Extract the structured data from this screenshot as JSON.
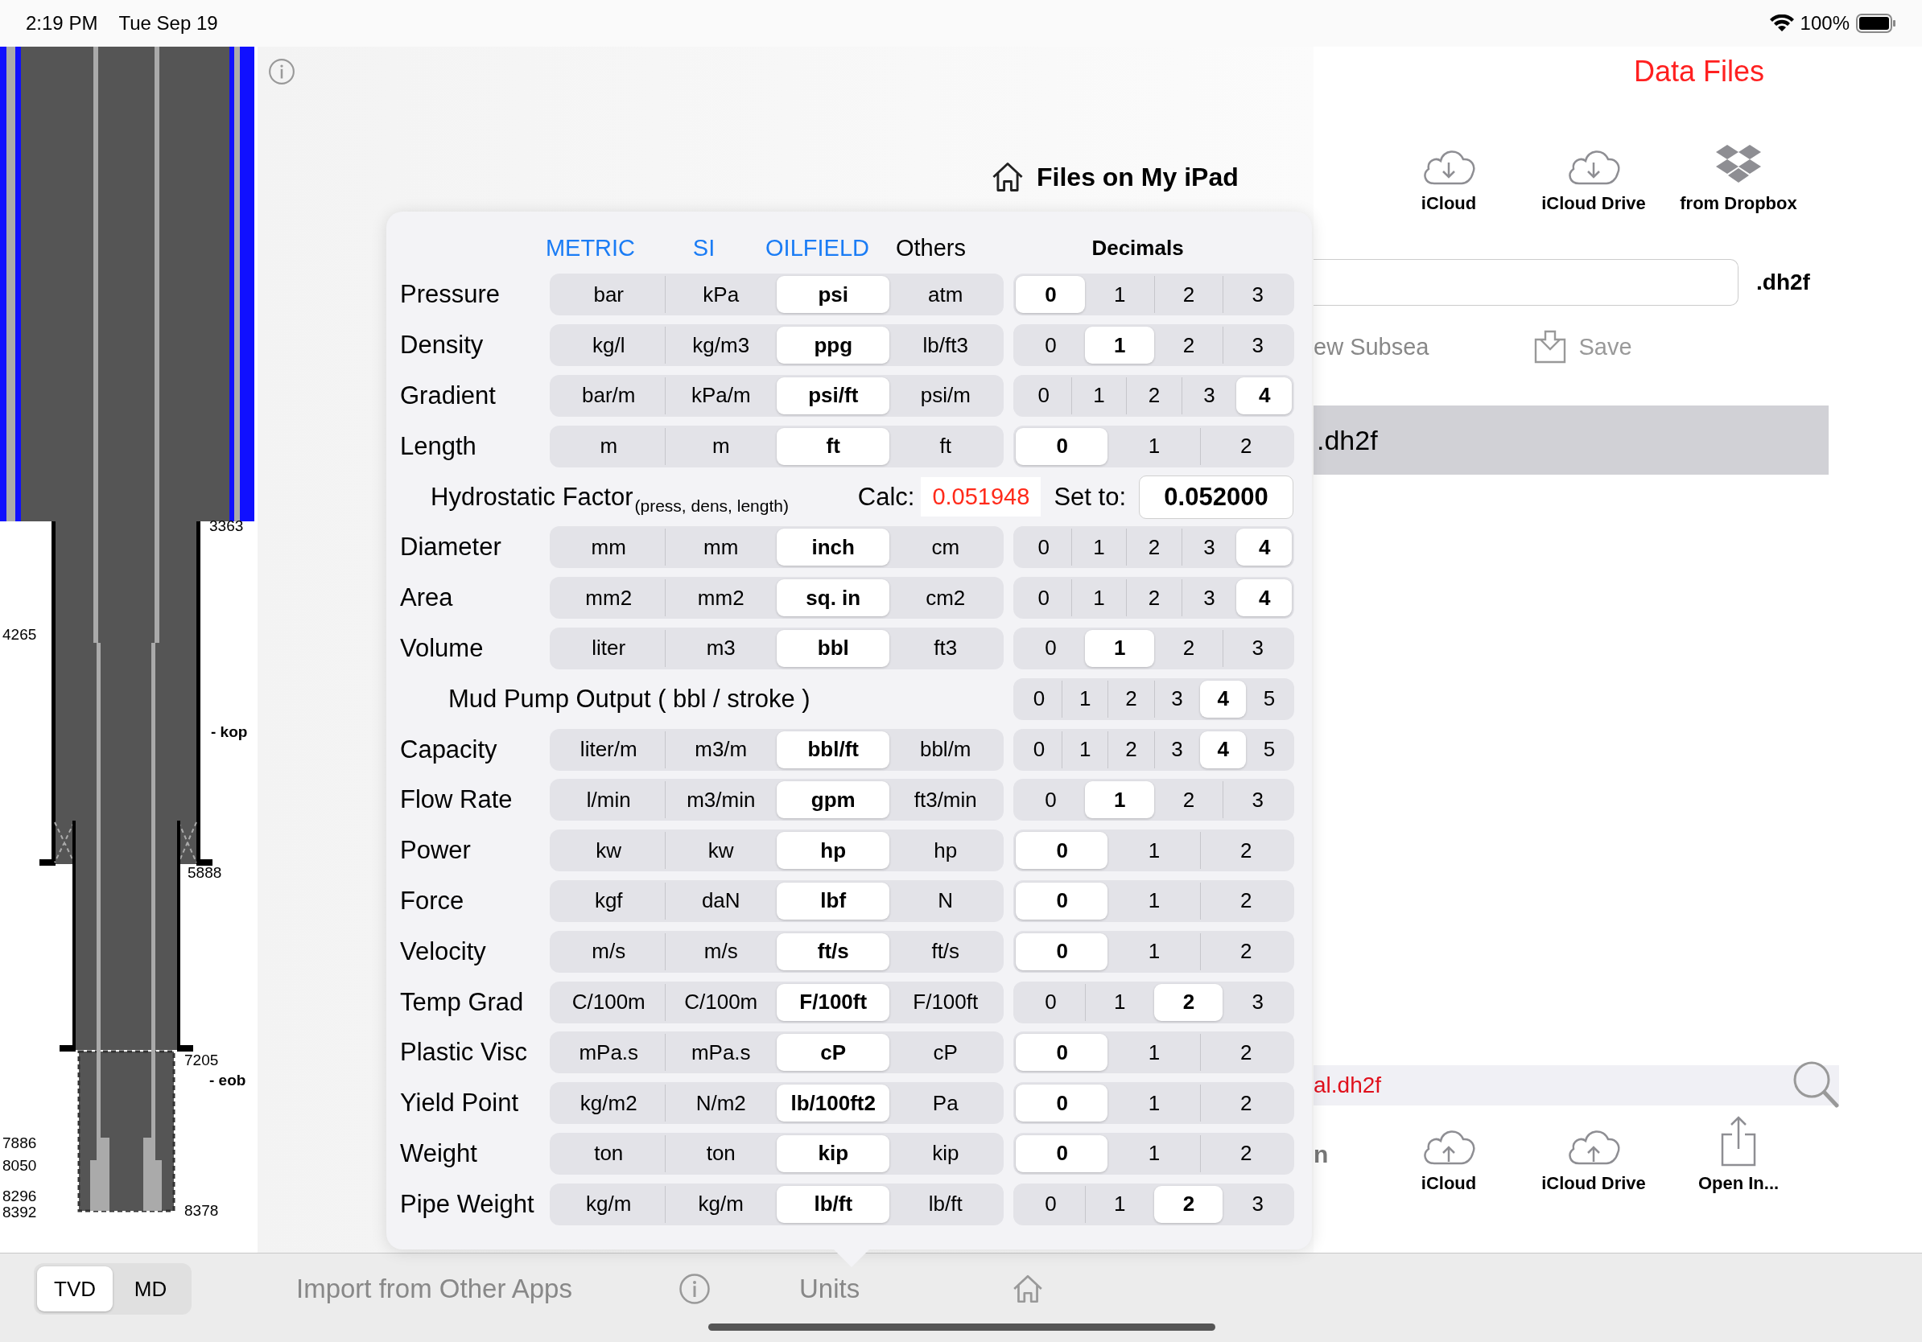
{
  "status_bar": {
    "time": "2:19 PM",
    "date": "Tue Sep 19",
    "battery": "100%"
  },
  "well": {
    "labels": [
      "3363",
      "4265",
      "- kop",
      "5888",
      "7205",
      "- eob",
      "7886",
      "8050",
      "8296",
      "8392",
      "8378"
    ]
  },
  "header": {
    "title": "Files on My iPad"
  },
  "data_files": "Data Files",
  "import_sources": [
    {
      "label": "iCloud",
      "kind": "cloud_down"
    },
    {
      "label": "iCloud Drive",
      "kind": "cloud_down"
    },
    {
      "label": "from Dropbox",
      "kind": "dropbox"
    }
  ],
  "filename_field": {
    "extension": ".dh2f"
  },
  "actions": {
    "partial_label": "ew Subsea",
    "save": "Save"
  },
  "selected_file": ".dh2f",
  "search": {
    "value": "al.dh2f"
  },
  "partial_text": "n",
  "export_targets": [
    {
      "label": "iCloud",
      "kind": "cloud_up"
    },
    {
      "label": "iCloud Drive",
      "kind": "cloud_up"
    },
    {
      "label": "Open In...",
      "kind": "share"
    }
  ],
  "units": {
    "systems": [
      {
        "label": "METRIC",
        "kind": "link"
      },
      {
        "label": "SI",
        "kind": "link"
      },
      {
        "label": "OILFIELD",
        "kind": "link"
      },
      {
        "label": "Others",
        "kind": "plain"
      }
    ],
    "decimals_title": "Decimals",
    "rows": [
      {
        "kind": "unit",
        "label": "Pressure",
        "units": [
          {
            "label": "bar",
            "selected": false
          },
          {
            "label": "kPa",
            "selected": false
          },
          {
            "label": "psi",
            "selected": true
          },
          {
            "label": "atm",
            "selected": false
          }
        ],
        "decimals": [
          {
            "label": "0",
            "selected": true
          },
          {
            "label": "1",
            "selected": false
          },
          {
            "label": "2",
            "selected": false
          },
          {
            "label": "3",
            "selected": false
          }
        ]
      },
      {
        "kind": "unit",
        "label": "Density",
        "units": [
          {
            "label": "kg/l",
            "selected": false
          },
          {
            "label": "kg/m3",
            "selected": false
          },
          {
            "label": "ppg",
            "selected": true
          },
          {
            "label": "lb/ft3",
            "selected": false
          }
        ],
        "decimals": [
          {
            "label": "0",
            "selected": false
          },
          {
            "label": "1",
            "selected": true
          },
          {
            "label": "2",
            "selected": false
          },
          {
            "label": "3",
            "selected": false
          }
        ]
      },
      {
        "kind": "unit",
        "label": "Gradient",
        "units": [
          {
            "label": "bar/m",
            "selected": false
          },
          {
            "label": "kPa/m",
            "selected": false
          },
          {
            "label": "psi/ft",
            "selected": true
          },
          {
            "label": "psi/m",
            "selected": false
          }
        ],
        "decimals": [
          {
            "label": "0",
            "selected": false
          },
          {
            "label": "1",
            "selected": false
          },
          {
            "label": "2",
            "selected": false
          },
          {
            "label": "3",
            "selected": false
          },
          {
            "label": "4",
            "selected": true
          }
        ]
      },
      {
        "kind": "unit",
        "label": "Length",
        "units": [
          {
            "label": "m",
            "selected": false
          },
          {
            "label": "m",
            "selected": false
          },
          {
            "label": "ft",
            "selected": true
          },
          {
            "label": "ft",
            "selected": false
          }
        ],
        "decimals": [
          {
            "label": "0",
            "selected": true
          },
          {
            "label": "1",
            "selected": false
          },
          {
            "label": "2",
            "selected": false
          }
        ]
      },
      {
        "kind": "hydrostatic",
        "label": "Hydrostatic Factor",
        "note": "(press, dens, length)",
        "calc_label": "Calc:",
        "calc_value": "0.051948",
        "set_label": "Set to:",
        "set_value": "0.052000"
      },
      {
        "kind": "unit",
        "label": "Diameter",
        "units": [
          {
            "label": "mm",
            "selected": false
          },
          {
            "label": "mm",
            "selected": false
          },
          {
            "label": "inch",
            "selected": true
          },
          {
            "label": "cm",
            "selected": false
          }
        ],
        "decimals": [
          {
            "label": "0",
            "selected": false
          },
          {
            "label": "1",
            "selected": false
          },
          {
            "label": "2",
            "selected": false
          },
          {
            "label": "3",
            "selected": false
          },
          {
            "label": "4",
            "selected": true
          }
        ]
      },
      {
        "kind": "unit",
        "label": "Area",
        "units": [
          {
            "label": "mm2",
            "selected": false
          },
          {
            "label": "mm2",
            "selected": false
          },
          {
            "label": "sq. in",
            "selected": true
          },
          {
            "label": "cm2",
            "selected": false
          }
        ],
        "decimals": [
          {
            "label": "0",
            "selected": false
          },
          {
            "label": "1",
            "selected": false
          },
          {
            "label": "2",
            "selected": false
          },
          {
            "label": "3",
            "selected": false
          },
          {
            "label": "4",
            "selected": true
          }
        ]
      },
      {
        "kind": "unit",
        "label": "Volume",
        "units": [
          {
            "label": "liter",
            "selected": false
          },
          {
            "label": "m3",
            "selected": false
          },
          {
            "label": "bbl",
            "selected": true
          },
          {
            "label": "ft3",
            "selected": false
          }
        ],
        "decimals": [
          {
            "label": "0",
            "selected": false
          },
          {
            "label": "1",
            "selected": true
          },
          {
            "label": "2",
            "selected": false
          },
          {
            "label": "3",
            "selected": false
          }
        ]
      },
      {
        "kind": "pump",
        "label": "Mud Pump Output (  bbl / stroke  )",
        "decimals": [
          {
            "label": "0",
            "selected": false
          },
          {
            "label": "1",
            "selected": false
          },
          {
            "label": "2",
            "selected": false
          },
          {
            "label": "3",
            "selected": false
          },
          {
            "label": "4",
            "selected": true
          },
          {
            "label": "5",
            "selected": false
          }
        ]
      },
      {
        "kind": "unit",
        "label": "Capacity",
        "units": [
          {
            "label": "liter/m",
            "selected": false
          },
          {
            "label": "m3/m",
            "selected": false
          },
          {
            "label": "bbl/ft",
            "selected": true
          },
          {
            "label": "bbl/m",
            "selected": false
          }
        ],
        "decimals": [
          {
            "label": "0",
            "selected": false
          },
          {
            "label": "1",
            "selected": false
          },
          {
            "label": "2",
            "selected": false
          },
          {
            "label": "3",
            "selected": false
          },
          {
            "label": "4",
            "selected": true
          },
          {
            "label": "5",
            "selected": false
          }
        ]
      },
      {
        "kind": "unit",
        "label": "Flow Rate",
        "units": [
          {
            "label": "l/min",
            "selected": false
          },
          {
            "label": "m3/min",
            "selected": false
          },
          {
            "label": "gpm",
            "selected": true
          },
          {
            "label": "ft3/min",
            "selected": false
          }
        ],
        "decimals": [
          {
            "label": "0",
            "selected": false
          },
          {
            "label": "1",
            "selected": true
          },
          {
            "label": "2",
            "selected": false
          },
          {
            "label": "3",
            "selected": false
          }
        ]
      },
      {
        "kind": "unit",
        "label": "Power",
        "units": [
          {
            "label": "kw",
            "selected": false
          },
          {
            "label": "kw",
            "selected": false
          },
          {
            "label": "hp",
            "selected": true
          },
          {
            "label": "hp",
            "selected": false
          }
        ],
        "decimals": [
          {
            "label": "0",
            "selected": true
          },
          {
            "label": "1",
            "selected": false
          },
          {
            "label": "2",
            "selected": false
          }
        ]
      },
      {
        "kind": "unit",
        "label": "Force",
        "units": [
          {
            "label": "kgf",
            "selected": false
          },
          {
            "label": "daN",
            "selected": false
          },
          {
            "label": "lbf",
            "selected": true
          },
          {
            "label": "N",
            "selected": false
          }
        ],
        "decimals": [
          {
            "label": "0",
            "selected": true
          },
          {
            "label": "1",
            "selected": false
          },
          {
            "label": "2",
            "selected": false
          }
        ]
      },
      {
        "kind": "unit",
        "label": "Velocity",
        "units": [
          {
            "label": "m/s",
            "selected": false
          },
          {
            "label": "m/s",
            "selected": false
          },
          {
            "label": "ft/s",
            "selected": true
          },
          {
            "label": "ft/s",
            "selected": false
          }
        ],
        "decimals": [
          {
            "label": "0",
            "selected": true
          },
          {
            "label": "1",
            "selected": false
          },
          {
            "label": "2",
            "selected": false
          }
        ]
      },
      {
        "kind": "unit",
        "label": "Temp Grad",
        "units": [
          {
            "label": "C/100m",
            "selected": false
          },
          {
            "label": "C/100m",
            "selected": false
          },
          {
            "label": "F/100ft",
            "selected": true
          },
          {
            "label": "F/100ft",
            "selected": false
          }
        ],
        "decimals": [
          {
            "label": "0",
            "selected": false
          },
          {
            "label": "1",
            "selected": false
          },
          {
            "label": "2",
            "selected": true
          },
          {
            "label": "3",
            "selected": false
          }
        ]
      },
      {
        "kind": "unit",
        "label": "Plastic Visc",
        "units": [
          {
            "label": "mPa.s",
            "selected": false
          },
          {
            "label": "mPa.s",
            "selected": false
          },
          {
            "label": "cP",
            "selected": true
          },
          {
            "label": "cP",
            "selected": false
          }
        ],
        "decimals": [
          {
            "label": "0",
            "selected": true
          },
          {
            "label": "1",
            "selected": false
          },
          {
            "label": "2",
            "selected": false
          }
        ]
      },
      {
        "kind": "unit",
        "label": "Yield Point",
        "units": [
          {
            "label": "kg/m2",
            "selected": false
          },
          {
            "label": "N/m2",
            "selected": false
          },
          {
            "label": "lb/100ft2",
            "selected": true
          },
          {
            "label": "Pa",
            "selected": false
          }
        ],
        "decimals": [
          {
            "label": "0",
            "selected": true
          },
          {
            "label": "1",
            "selected": false
          },
          {
            "label": "2",
            "selected": false
          }
        ]
      },
      {
        "kind": "unit",
        "label": "Weight",
        "units": [
          {
            "label": "ton",
            "selected": false
          },
          {
            "label": "ton",
            "selected": false
          },
          {
            "label": "kip",
            "selected": true
          },
          {
            "label": "kip",
            "selected": false
          }
        ],
        "decimals": [
          {
            "label": "0",
            "selected": true
          },
          {
            "label": "1",
            "selected": false
          },
          {
            "label": "2",
            "selected": false
          }
        ]
      },
      {
        "kind": "unit",
        "label": "Pipe Weight",
        "units": [
          {
            "label": "kg/m",
            "selected": false
          },
          {
            "label": "kg/m",
            "selected": false
          },
          {
            "label": "lb/ft",
            "selected": true
          },
          {
            "label": "lb/ft",
            "selected": false
          }
        ],
        "decimals": [
          {
            "label": "0",
            "selected": false
          },
          {
            "label": "1",
            "selected": false
          },
          {
            "label": "2",
            "selected": true
          },
          {
            "label": "3",
            "selected": false
          }
        ]
      }
    ]
  },
  "depth_mode": [
    {
      "label": "TVD",
      "selected": true
    },
    {
      "label": "MD",
      "selected": false
    }
  ],
  "tabs": [
    {
      "kind": "text",
      "label": "Import from Other Apps"
    },
    {
      "kind": "info"
    },
    {
      "kind": "text",
      "label": "Units"
    },
    {
      "kind": "home"
    }
  ]
}
